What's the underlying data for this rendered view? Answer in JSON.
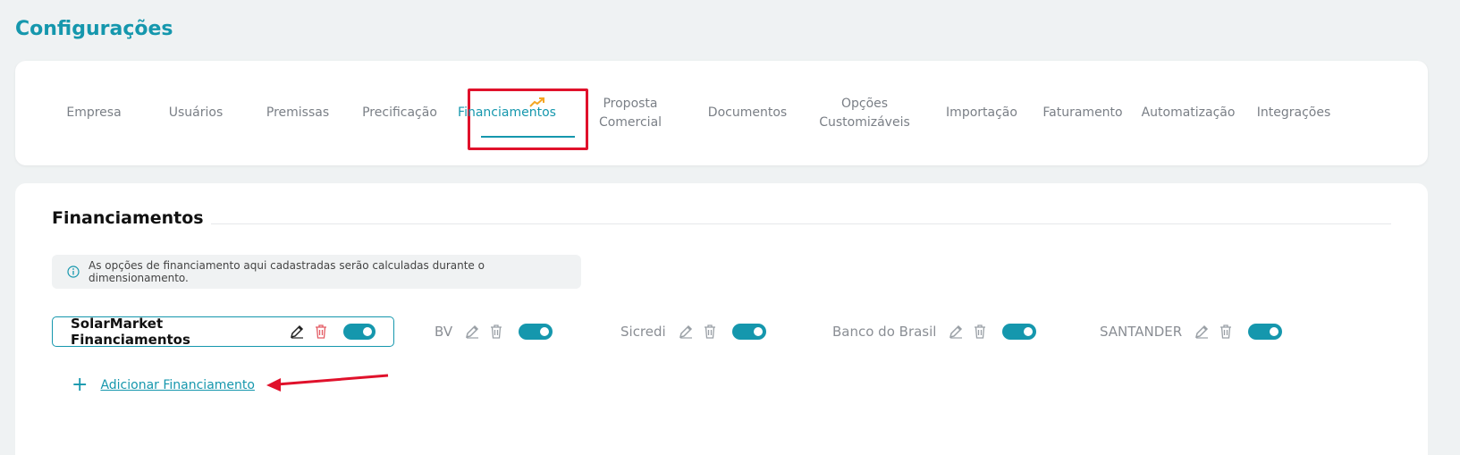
{
  "page": {
    "title": "Configurações"
  },
  "tabs": [
    {
      "label": "Empresa"
    },
    {
      "label": "Usuários"
    },
    {
      "label": "Premissas"
    },
    {
      "label": "Precificação"
    },
    {
      "label": "Financiamentos",
      "active": true,
      "icon": "trending-up-icon"
    },
    {
      "label_line1": "Proposta",
      "label_line2": "Comercial"
    },
    {
      "label": "Documentos"
    },
    {
      "label_line1": "Opções",
      "label_line2": "Customizáveis"
    },
    {
      "label": "Importação"
    },
    {
      "label": "Faturamento"
    },
    {
      "label": "Automatização"
    },
    {
      "label": "Integrações"
    }
  ],
  "section": {
    "title": "Financiamentos",
    "info_text": "As opções de financiamento aqui cadastradas serão calculadas durante o dimensionamento."
  },
  "financings": [
    {
      "name": "SolarMarket Financiamentos",
      "enabled": true,
      "selected": true
    },
    {
      "name": "BV",
      "enabled": true
    },
    {
      "name": "Sicredi",
      "enabled": true
    },
    {
      "name": "Banco do Brasil",
      "enabled": true
    },
    {
      "name": "SANTANDER",
      "enabled": true
    }
  ],
  "add": {
    "plus": "+",
    "label": "Adicionar Financiamento"
  },
  "colors": {
    "accent": "#1597ad",
    "highlight": "#e0112b",
    "delete_active": "#e35b63",
    "trend": "#f5a623"
  }
}
